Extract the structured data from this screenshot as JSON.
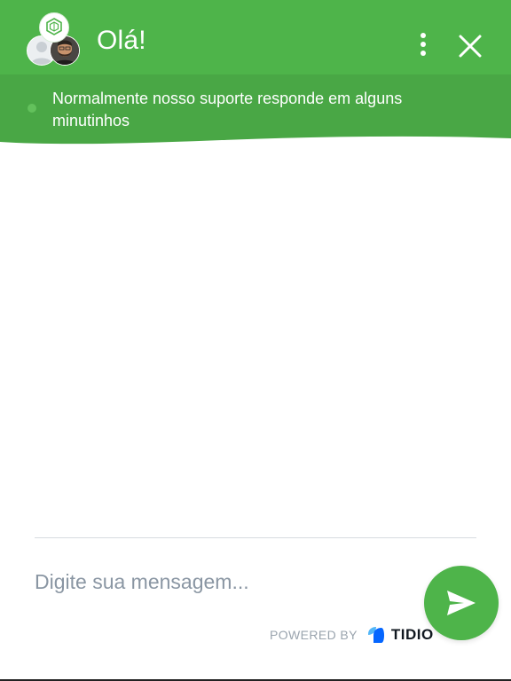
{
  "header": {
    "title": "Olá!",
    "avatars": [
      "logo-avatar",
      "generic-user-avatar",
      "agent-avatar"
    ],
    "menu_icon": "more-vertical-icon",
    "close_icon": "close-icon"
  },
  "status": {
    "message": "Normalmente nosso suporte responde em alguns minutinhos",
    "online_icon": "online-dot-icon"
  },
  "composer": {
    "placeholder": "Digite sua mensagem...",
    "send_icon": "send-icon"
  },
  "footer": {
    "powered_by": "POWERED BY",
    "brand": "TIDIO",
    "brand_icon": "tidio-logo-icon"
  },
  "colors": {
    "primary": "#4eb44a",
    "status_bar": "#49a745",
    "online_dot": "#63c15c",
    "brand_blue": "#0566ff"
  }
}
